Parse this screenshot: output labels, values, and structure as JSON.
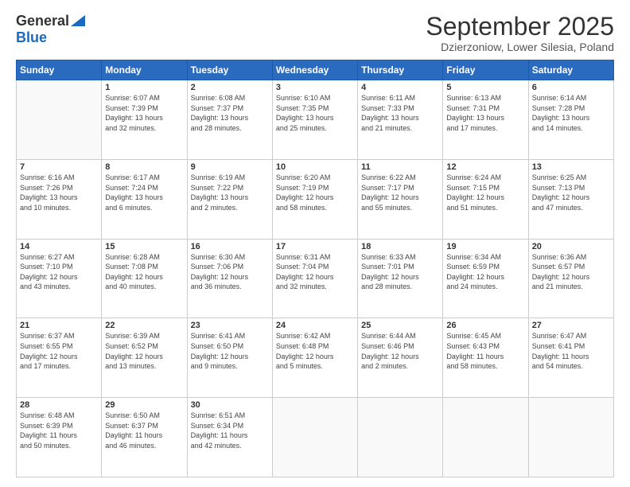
{
  "logo": {
    "general": "General",
    "blue": "Blue"
  },
  "header": {
    "month": "September 2025",
    "location": "Dzierzoniow, Lower Silesia, Poland"
  },
  "weekdays": [
    "Sunday",
    "Monday",
    "Tuesday",
    "Wednesday",
    "Thursday",
    "Friday",
    "Saturday"
  ],
  "weeks": [
    [
      {
        "day": "",
        "info": ""
      },
      {
        "day": "1",
        "info": "Sunrise: 6:07 AM\nSunset: 7:39 PM\nDaylight: 13 hours\nand 32 minutes."
      },
      {
        "day": "2",
        "info": "Sunrise: 6:08 AM\nSunset: 7:37 PM\nDaylight: 13 hours\nand 28 minutes."
      },
      {
        "day": "3",
        "info": "Sunrise: 6:10 AM\nSunset: 7:35 PM\nDaylight: 13 hours\nand 25 minutes."
      },
      {
        "day": "4",
        "info": "Sunrise: 6:11 AM\nSunset: 7:33 PM\nDaylight: 13 hours\nand 21 minutes."
      },
      {
        "day": "5",
        "info": "Sunrise: 6:13 AM\nSunset: 7:31 PM\nDaylight: 13 hours\nand 17 minutes."
      },
      {
        "day": "6",
        "info": "Sunrise: 6:14 AM\nSunset: 7:28 PM\nDaylight: 13 hours\nand 14 minutes."
      }
    ],
    [
      {
        "day": "7",
        "info": "Sunrise: 6:16 AM\nSunset: 7:26 PM\nDaylight: 13 hours\nand 10 minutes."
      },
      {
        "day": "8",
        "info": "Sunrise: 6:17 AM\nSunset: 7:24 PM\nDaylight: 13 hours\nand 6 minutes."
      },
      {
        "day": "9",
        "info": "Sunrise: 6:19 AM\nSunset: 7:22 PM\nDaylight: 13 hours\nand 2 minutes."
      },
      {
        "day": "10",
        "info": "Sunrise: 6:20 AM\nSunset: 7:19 PM\nDaylight: 12 hours\nand 58 minutes."
      },
      {
        "day": "11",
        "info": "Sunrise: 6:22 AM\nSunset: 7:17 PM\nDaylight: 12 hours\nand 55 minutes."
      },
      {
        "day": "12",
        "info": "Sunrise: 6:24 AM\nSunset: 7:15 PM\nDaylight: 12 hours\nand 51 minutes."
      },
      {
        "day": "13",
        "info": "Sunrise: 6:25 AM\nSunset: 7:13 PM\nDaylight: 12 hours\nand 47 minutes."
      }
    ],
    [
      {
        "day": "14",
        "info": "Sunrise: 6:27 AM\nSunset: 7:10 PM\nDaylight: 12 hours\nand 43 minutes."
      },
      {
        "day": "15",
        "info": "Sunrise: 6:28 AM\nSunset: 7:08 PM\nDaylight: 12 hours\nand 40 minutes."
      },
      {
        "day": "16",
        "info": "Sunrise: 6:30 AM\nSunset: 7:06 PM\nDaylight: 12 hours\nand 36 minutes."
      },
      {
        "day": "17",
        "info": "Sunrise: 6:31 AM\nSunset: 7:04 PM\nDaylight: 12 hours\nand 32 minutes."
      },
      {
        "day": "18",
        "info": "Sunrise: 6:33 AM\nSunset: 7:01 PM\nDaylight: 12 hours\nand 28 minutes."
      },
      {
        "day": "19",
        "info": "Sunrise: 6:34 AM\nSunset: 6:59 PM\nDaylight: 12 hours\nand 24 minutes."
      },
      {
        "day": "20",
        "info": "Sunrise: 6:36 AM\nSunset: 6:57 PM\nDaylight: 12 hours\nand 21 minutes."
      }
    ],
    [
      {
        "day": "21",
        "info": "Sunrise: 6:37 AM\nSunset: 6:55 PM\nDaylight: 12 hours\nand 17 minutes."
      },
      {
        "day": "22",
        "info": "Sunrise: 6:39 AM\nSunset: 6:52 PM\nDaylight: 12 hours\nand 13 minutes."
      },
      {
        "day": "23",
        "info": "Sunrise: 6:41 AM\nSunset: 6:50 PM\nDaylight: 12 hours\nand 9 minutes."
      },
      {
        "day": "24",
        "info": "Sunrise: 6:42 AM\nSunset: 6:48 PM\nDaylight: 12 hours\nand 5 minutes."
      },
      {
        "day": "25",
        "info": "Sunrise: 6:44 AM\nSunset: 6:46 PM\nDaylight: 12 hours\nand 2 minutes."
      },
      {
        "day": "26",
        "info": "Sunrise: 6:45 AM\nSunset: 6:43 PM\nDaylight: 11 hours\nand 58 minutes."
      },
      {
        "day": "27",
        "info": "Sunrise: 6:47 AM\nSunset: 6:41 PM\nDaylight: 11 hours\nand 54 minutes."
      }
    ],
    [
      {
        "day": "28",
        "info": "Sunrise: 6:48 AM\nSunset: 6:39 PM\nDaylight: 11 hours\nand 50 minutes."
      },
      {
        "day": "29",
        "info": "Sunrise: 6:50 AM\nSunset: 6:37 PM\nDaylight: 11 hours\nand 46 minutes."
      },
      {
        "day": "30",
        "info": "Sunrise: 6:51 AM\nSunset: 6:34 PM\nDaylight: 11 hours\nand 42 minutes."
      },
      {
        "day": "",
        "info": ""
      },
      {
        "day": "",
        "info": ""
      },
      {
        "day": "",
        "info": ""
      },
      {
        "day": "",
        "info": ""
      }
    ]
  ]
}
